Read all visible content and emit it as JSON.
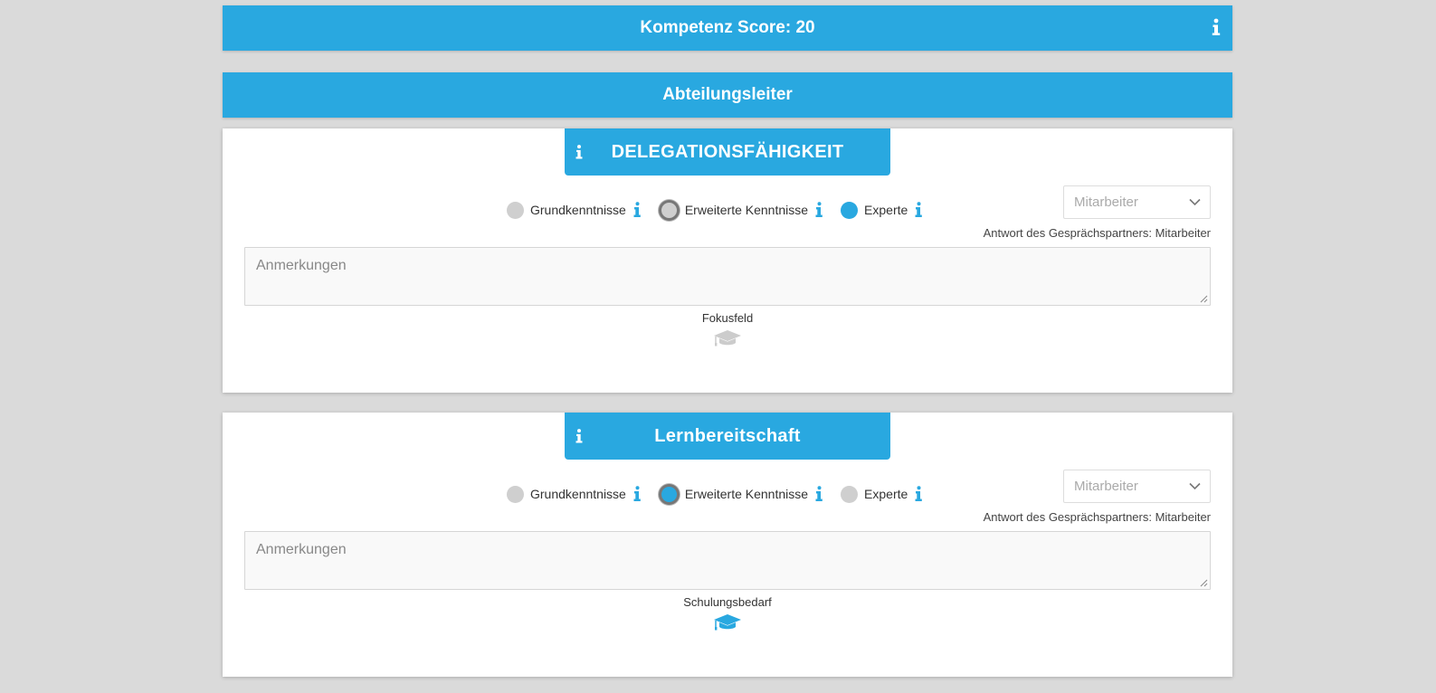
{
  "score_bar": {
    "label": "Kompetenz Score: 20"
  },
  "role_bar": {
    "label": "Abteilungsleiter"
  },
  "colors": {
    "accent": "#29a8e0",
    "radio_off": "#cfcfcf",
    "cap_off": "#cccccc"
  },
  "cards": [
    {
      "title": "DELEGATIONSFÄHIGKEIT",
      "options": [
        {
          "label": "Grundkenntnisse",
          "state": "off"
        },
        {
          "label": "Erweiterte Kenntnisse",
          "state": "focused"
        },
        {
          "label": "Experte",
          "state": "selected"
        }
      ],
      "select_value": "Mitarbeiter",
      "answer_text": "Antwort des Gesprächspartners: Mitarbeiter",
      "notes_placeholder": "Anmerkungen",
      "focus_label": "Fokusfeld",
      "focus_icon": "graduation-cap-icon",
      "focus_active": false
    },
    {
      "title": "Lernbereitschaft",
      "options": [
        {
          "label": "Grundkenntnisse",
          "state": "off"
        },
        {
          "label": "Erweiterte Kenntnisse",
          "state": "selected-focused"
        },
        {
          "label": "Experte",
          "state": "off"
        }
      ],
      "select_value": "Mitarbeiter",
      "answer_text": "Antwort des Gesprächspartners: Mitarbeiter",
      "notes_placeholder": "Anmerkungen",
      "focus_label": "Schulungsbedarf",
      "focus_icon": "graduation-cap-icon",
      "focus_active": true
    }
  ]
}
